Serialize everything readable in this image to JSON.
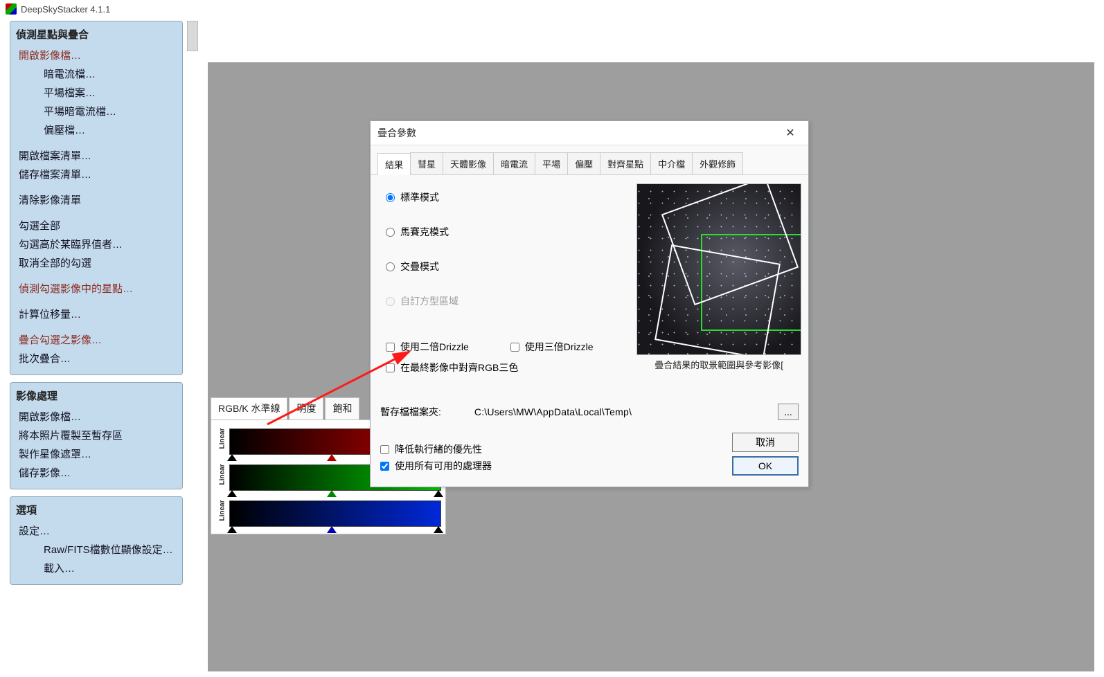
{
  "app": {
    "title": "DeepSkyStacker 4.1.1"
  },
  "sidebar": {
    "section1": {
      "title": "偵測星點與疊合",
      "items": [
        {
          "label": "開啟影像檔…",
          "accent": true
        },
        {
          "label": "暗電流檔…",
          "indent": true
        },
        {
          "label": "平場檔案…",
          "indent": true
        },
        {
          "label": "平場暗電流檔…",
          "indent": true
        },
        {
          "label": "偏壓檔…",
          "indent": true
        },
        {
          "label": "開啟檔案清單…"
        },
        {
          "label": "儲存檔案清單…"
        },
        {
          "label": "清除影像清單"
        },
        {
          "label": "勾選全部"
        },
        {
          "label": "勾選高於某臨界值者…"
        },
        {
          "label": "取消全部的勾選"
        },
        {
          "label": "偵測勾選影像中的星點…",
          "accent": true
        },
        {
          "label": "計算位移量…"
        },
        {
          "label": "疊合勾選之影像…",
          "accent": true
        },
        {
          "label": "批次疊合…"
        }
      ]
    },
    "section2": {
      "title": "影像處理",
      "items": [
        {
          "label": "開啟影像檔…"
        },
        {
          "label": "將本照片覆製至暫存區"
        },
        {
          "label": "製作星像遮罩…"
        },
        {
          "label": "儲存影像…"
        }
      ]
    },
    "section3": {
      "title": "選項",
      "items": [
        {
          "label": "設定…"
        },
        {
          "label": "Raw/FITS檔數位顯像設定…",
          "indent": true
        },
        {
          "label": "載入…",
          "indent": true
        }
      ]
    }
  },
  "bottomTabs": {
    "tab1": "RGB/K 水準線",
    "tab2": "明度",
    "tab3": "飽和",
    "rampLabel": "Linear"
  },
  "dialog": {
    "title": "疊合參數",
    "tabs": [
      "結果",
      "彗星",
      "天體影像",
      "暗電流",
      "平場",
      "偏壓",
      "對齊星點",
      "中介檔",
      "外觀修飾"
    ],
    "radios": {
      "standard": "標準模式",
      "mosaic": "馬賽克模式",
      "overlay": "交疊模式",
      "custom": "自訂方型區域"
    },
    "drizzle2x": "使用二倍Drizzle",
    "drizzle3x": "使用三倍Drizzle",
    "rgbAlign": "在最終影像中對齊RGB三色",
    "previewCaption": "疊合結果的取景範圍與參考影像[",
    "tempLabel": "暫存檔檔案夾:",
    "tempPath": "C:\\Users\\MW\\AppData\\Local\\Temp\\",
    "tempBrowse": "...",
    "lowerPriority": "降低執行緒的優先性",
    "useAllCpus": "使用所有可用的處理器",
    "cancel": "取消",
    "ok": "OK"
  }
}
